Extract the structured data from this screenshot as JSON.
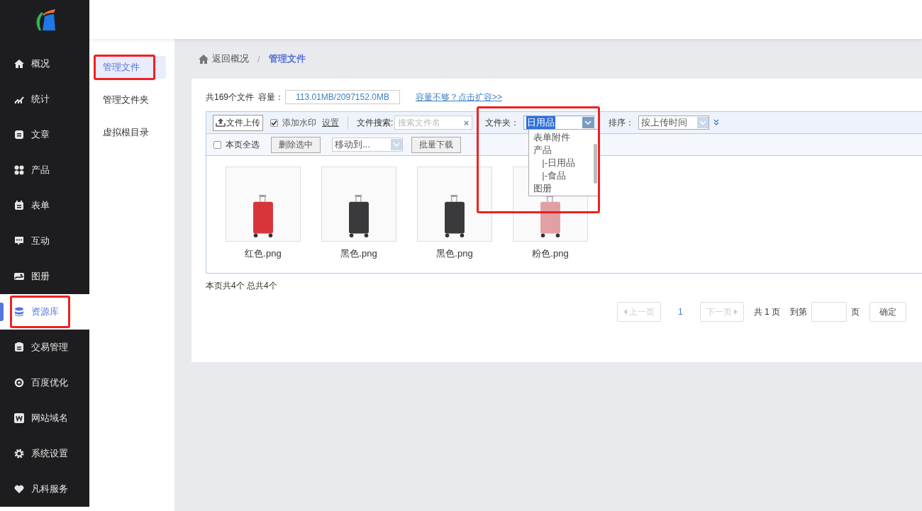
{
  "sidebar": {
    "items": [
      {
        "label": "概况",
        "selected": false,
        "highlighted": false
      },
      {
        "label": "统计",
        "selected": false,
        "highlighted": false
      },
      {
        "label": "文章",
        "selected": false,
        "highlighted": false
      },
      {
        "label": "产品",
        "selected": false,
        "highlighted": false
      },
      {
        "label": "表单",
        "selected": false,
        "highlighted": false
      },
      {
        "label": "互动",
        "selected": false,
        "highlighted": false
      },
      {
        "label": "图册",
        "selected": false,
        "highlighted": false
      },
      {
        "label": "资源库",
        "selected": true,
        "highlighted": true
      },
      {
        "label": "交易管理",
        "selected": false,
        "highlighted": false
      },
      {
        "label": "百度优化",
        "selected": false,
        "highlighted": false
      },
      {
        "label": "网站域名",
        "selected": false,
        "highlighted": false
      },
      {
        "label": "系统设置",
        "selected": false,
        "highlighted": false
      },
      {
        "label": "凡科服务",
        "selected": false,
        "highlighted": false
      }
    ]
  },
  "subnav": {
    "items": [
      {
        "label": "管理文件",
        "selected": true,
        "highlighted": true
      },
      {
        "label": "管理文件夹",
        "selected": false,
        "highlighted": false
      },
      {
        "label": "虚拟根目录",
        "selected": false,
        "highlighted": false
      }
    ]
  },
  "breadcrumb": {
    "back": "返回概况",
    "separator": "/",
    "current": "管理文件"
  },
  "summary": {
    "file_count": "共169个文件",
    "capacity_label": "容量：",
    "capacity": "113.01MB/2097152.0MB",
    "expand_link": "容量不够？点击扩容>>"
  },
  "toolbar": {
    "upload": "文件上传",
    "watermark": {
      "label": "添加水印",
      "checked": true
    },
    "watermark_settings": "设置",
    "search_label": "文件搜索:",
    "search": {
      "placeholder": "搜索文件名"
    },
    "clear": "×",
    "folder": {
      "label": "文件夹：",
      "value": "日用品",
      "expanded": true,
      "highlighted": true,
      "options": [
        {
          "label": "表单附件"
        },
        {
          "label": "产品",
          "children": [
            {
              "label": "|-日用品"
            },
            {
              "label": "|-食品"
            }
          ]
        },
        {
          "label": "图册"
        }
      ]
    },
    "sort": {
      "label": "排序：",
      "value": "按上传时间"
    }
  },
  "actions": {
    "select_all": {
      "label": "本页全选",
      "checked": false
    },
    "delete": "删除选中",
    "move": "移动到...",
    "download": "批量下载"
  },
  "files": [
    {
      "name": "红色.png",
      "color": "#d8353a"
    },
    {
      "name": "黑色.png",
      "color": "#3a3a3c"
    },
    {
      "name": "黑色.png",
      "color": "#3a3a3c"
    },
    {
      "name": "粉色.png",
      "color": "#e2a0a4"
    }
  ],
  "footer": "本页共4个 总共4个",
  "pagination": {
    "prev": "上一页",
    "page": "1",
    "next": "下一页",
    "total": "共 1 页",
    "goto": "到第",
    "unit": "页",
    "confirm": "确定"
  }
}
